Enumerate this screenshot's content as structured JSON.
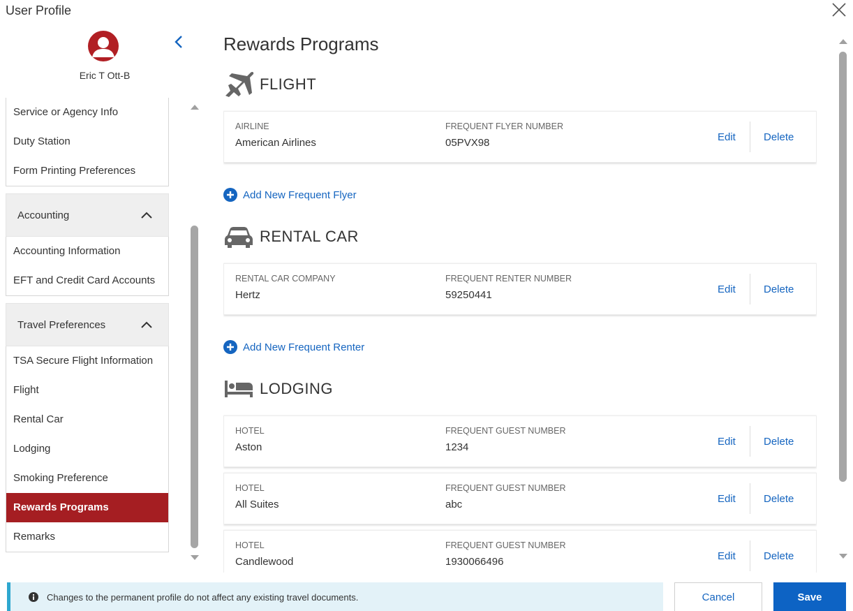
{
  "window": {
    "title": "User Profile"
  },
  "user": {
    "name": "Eric T Ott-B"
  },
  "nav": {
    "top_items": [
      {
        "label": "Service or Agency Info"
      },
      {
        "label": "Duty Station"
      },
      {
        "label": "Form Printing Preferences"
      }
    ],
    "groups": [
      {
        "label": "Accounting",
        "items": [
          {
            "label": "Accounting Information"
          },
          {
            "label": "EFT and Credit Card Accounts"
          }
        ]
      },
      {
        "label": "Travel Preferences",
        "items": [
          {
            "label": "TSA Secure Flight Information"
          },
          {
            "label": "Flight"
          },
          {
            "label": "Rental Car"
          },
          {
            "label": "Lodging"
          },
          {
            "label": "Smoking Preference"
          },
          {
            "label": "Rewards Programs",
            "active": true
          },
          {
            "label": "Remarks"
          }
        ]
      }
    ]
  },
  "main": {
    "title": "Rewards Programs",
    "edit_label": "Edit",
    "delete_label": "Delete",
    "flight": {
      "title": "FLIGHT",
      "icon": "airplane-icon",
      "col1_label": "AIRLINE",
      "col2_label": "FREQUENT FLYER NUMBER",
      "rows": [
        {
          "name": "American Airlines",
          "number": "05PVX98"
        }
      ],
      "add_label": "Add New Frequent Flyer"
    },
    "rental": {
      "title": "RENTAL CAR",
      "icon": "car-icon",
      "col1_label": "RENTAL CAR COMPANY",
      "col2_label": "FREQUENT RENTER NUMBER",
      "rows": [
        {
          "name": "Hertz",
          "number": "59250441"
        }
      ],
      "add_label": "Add New Frequent Renter"
    },
    "lodging": {
      "title": "LODGING",
      "icon": "bed-icon",
      "col1_label": "HOTEL",
      "col2_label": "FREQUENT GUEST NUMBER",
      "rows": [
        {
          "name": "Aston",
          "number": "1234"
        },
        {
          "name": "All Suites",
          "number": "abc"
        },
        {
          "name": "Candlewood",
          "number": "1930066496"
        }
      ]
    }
  },
  "footer": {
    "notice": "Changes to the permanent profile do not affect any existing travel documents.",
    "cancel_label": "Cancel",
    "save_label": "Save"
  },
  "colors": {
    "brand_red": "#a51e22",
    "link_blue": "#1565c0",
    "primary_button": "#0d63c4",
    "notice_bg": "#e3f2f8",
    "notice_border": "#2ea7cf"
  }
}
